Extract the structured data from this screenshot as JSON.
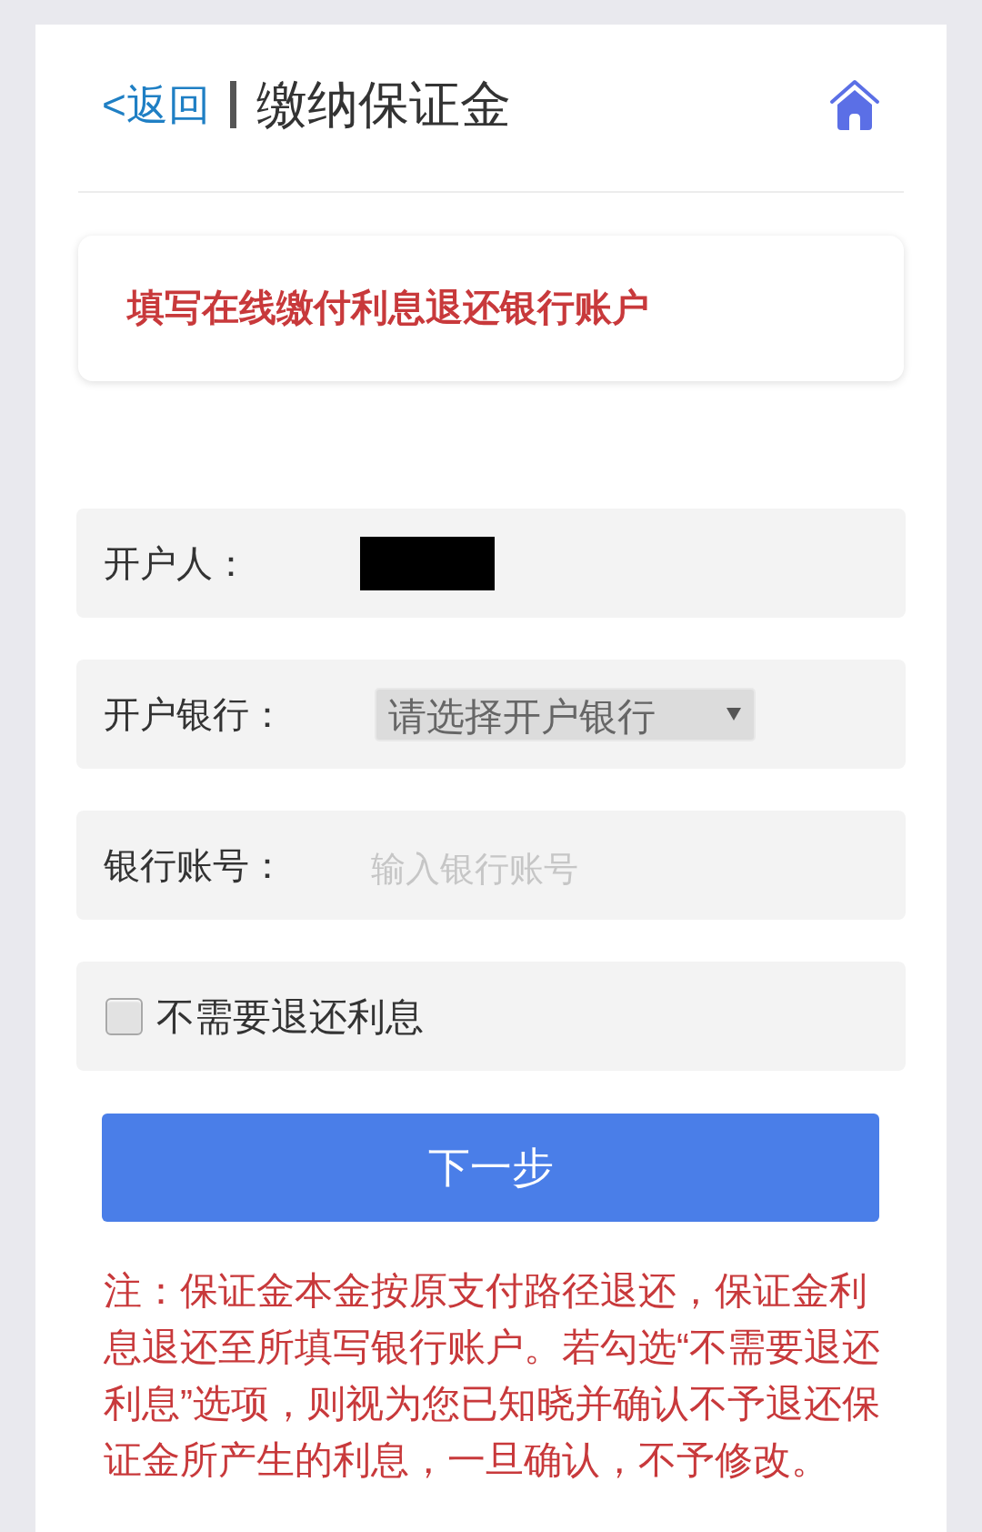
{
  "header": {
    "back_link": "<返回",
    "title": "缴纳保证金"
  },
  "notice_card": {
    "text": "填写在线缴付利息退还银行账户"
  },
  "form": {
    "rows": [
      {
        "kind": "redacted",
        "label": "开户人："
      },
      {
        "kind": "select",
        "label": "开户银行：",
        "value": "请选择开户银行"
      },
      {
        "kind": "input",
        "label": "银行账号：",
        "placeholder": "输入银行账号"
      },
      {
        "kind": "checkbox",
        "label": "不需要退还利息",
        "checked": false
      }
    ]
  },
  "next_button": {
    "label": "下一步"
  },
  "note": {
    "text": "注：保证金本金按原支付路径退还，保证金利息退还至所填写银行账户。若勾选“不需要退还利息”选项，则视为您已知晓并确认不予退还保证金所产生的利息，一旦确认，不予修改。"
  }
}
